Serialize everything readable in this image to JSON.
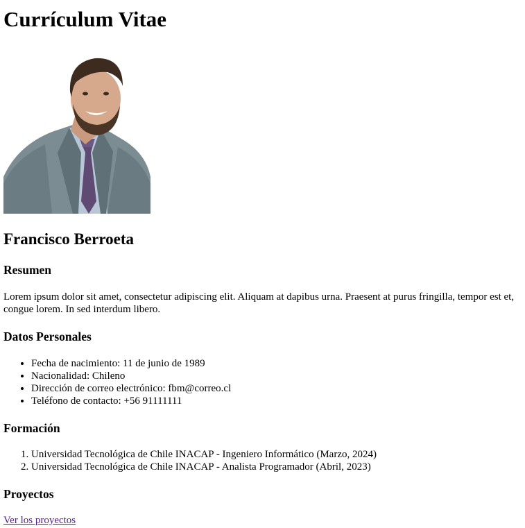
{
  "page_title": "Currículum Vitae",
  "photo": {
    "icon": "profile-photo"
  },
  "name": "Francisco Berroeta",
  "sections": {
    "resumen": {
      "title": "Resumen",
      "text": "Lorem ipsum dolor sit amet, consectetur adipiscing elit. Aliquam at dapibus urna. Praesent at purus fringilla, tempor est et, congue lorem. In sed interdum libero."
    },
    "datos": {
      "title": "Datos Personales",
      "items": [
        "Fecha de nacimiento: 11 de junio de 1989",
        "Nacionalidad: Chileno",
        "Dirección de correo electrónico: fbm@correo.cl",
        "Teléfono de contacto: +56 91111111"
      ]
    },
    "formacion": {
      "title": "Formación",
      "items": [
        "Universidad Tecnológica de Chile INACAP - Ingeniero Informático (Marzo, 2024)",
        "Universidad Tecnológica de Chile INACAP - Analista Programador (Abril, 2023)"
      ]
    },
    "proyectos": {
      "title": "Proyectos",
      "link_label": "Ver los proyectos"
    }
  },
  "colors": {
    "link_visited": "#551a8b",
    "text": "#000000"
  }
}
